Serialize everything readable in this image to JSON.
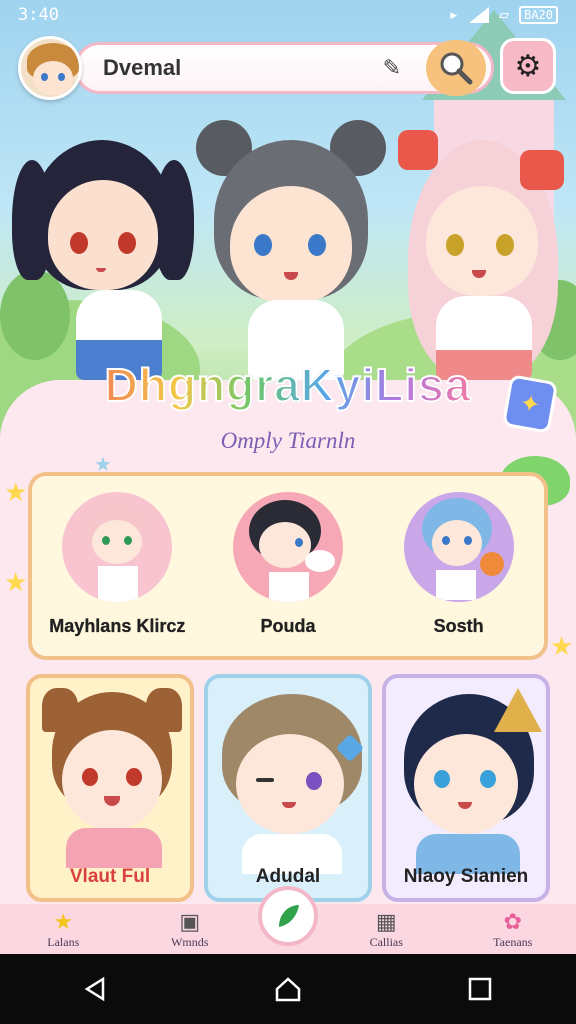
{
  "status_bar": {
    "time": "3:40",
    "battery": "BA20"
  },
  "search": {
    "value": "Dvemal"
  },
  "game": {
    "title": "DhgngraKyiLisa",
    "subtitle": "Omply Tiarnln"
  },
  "featured": [
    {
      "name": "Mayhlans Klircz"
    },
    {
      "name": "Pouda"
    },
    {
      "name": "Sosth"
    }
  ],
  "cards": [
    {
      "name": "Vlaut Ful",
      "accent": "#f2c18a",
      "bg": "#fff1c8"
    },
    {
      "name": "Adudal",
      "accent": "#9fd2ea",
      "bg": "#d9f0fb"
    },
    {
      "name": "Nlaoy Sianien",
      "accent": "#c6b2e6",
      "bg": "#f3ecff"
    }
  ],
  "bottom_nav": [
    {
      "label": "Lalans",
      "icon": "star-icon"
    },
    {
      "label": "Wmnds",
      "icon": "box-icon"
    },
    {
      "label": "Callias",
      "icon": "calendar-icon"
    },
    {
      "label": "Taenans",
      "icon": "flower-icon"
    }
  ],
  "colors": {
    "accent_pink": "#f3b7c7",
    "accent_orange": "#f6c27d",
    "bg": "#fde8ef"
  }
}
